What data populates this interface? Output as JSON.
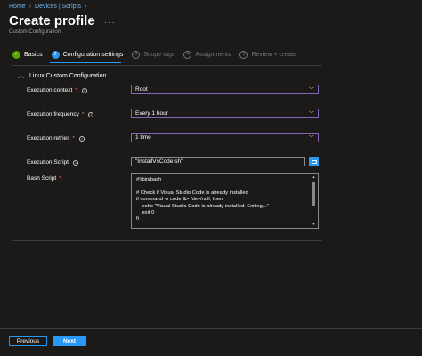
{
  "breadcrumb": [
    "Home",
    "Devices | Scripts"
  ],
  "header": {
    "title": "Create profile",
    "subtitle": "Custom Configuration",
    "more": "···"
  },
  "steps": [
    {
      "num": "✓",
      "label": "Basics",
      "state": "done"
    },
    {
      "num": "2",
      "label": "Configuration settings",
      "state": "active"
    },
    {
      "num": "3",
      "label": "Scope tags",
      "state": "pending"
    },
    {
      "num": "4",
      "label": "Assignments",
      "state": "pending"
    },
    {
      "num": "5",
      "label": "Review + create",
      "state": "pending"
    }
  ],
  "section": {
    "title": "Linux Custom Configuration"
  },
  "form": {
    "context_label": "Execution context",
    "context_value": "Root",
    "frequency_label": "Execution frequency",
    "frequency_value": "Every 1 hour",
    "retries_label": "Execution retries",
    "retries_value": "1 time",
    "script_label": "Execution Script",
    "script_value": "\"InstallVsCode.sh\"",
    "bash_label": "Bash Script",
    "bash_code": "#!/bin/bash\n\n# Check if Visual Studio Code is already installed\nif command -v code &> /dev/null; then\n    echo \"Visual Studio Code is already installed. Exiting...\"\n    exit 0\nfi"
  },
  "footer": {
    "previous": "Previous",
    "next": "Next"
  },
  "colors": {
    "accent": "#2899f5",
    "focus_border": "#8764b8",
    "done": "#57a300",
    "required": "#f1707b"
  }
}
